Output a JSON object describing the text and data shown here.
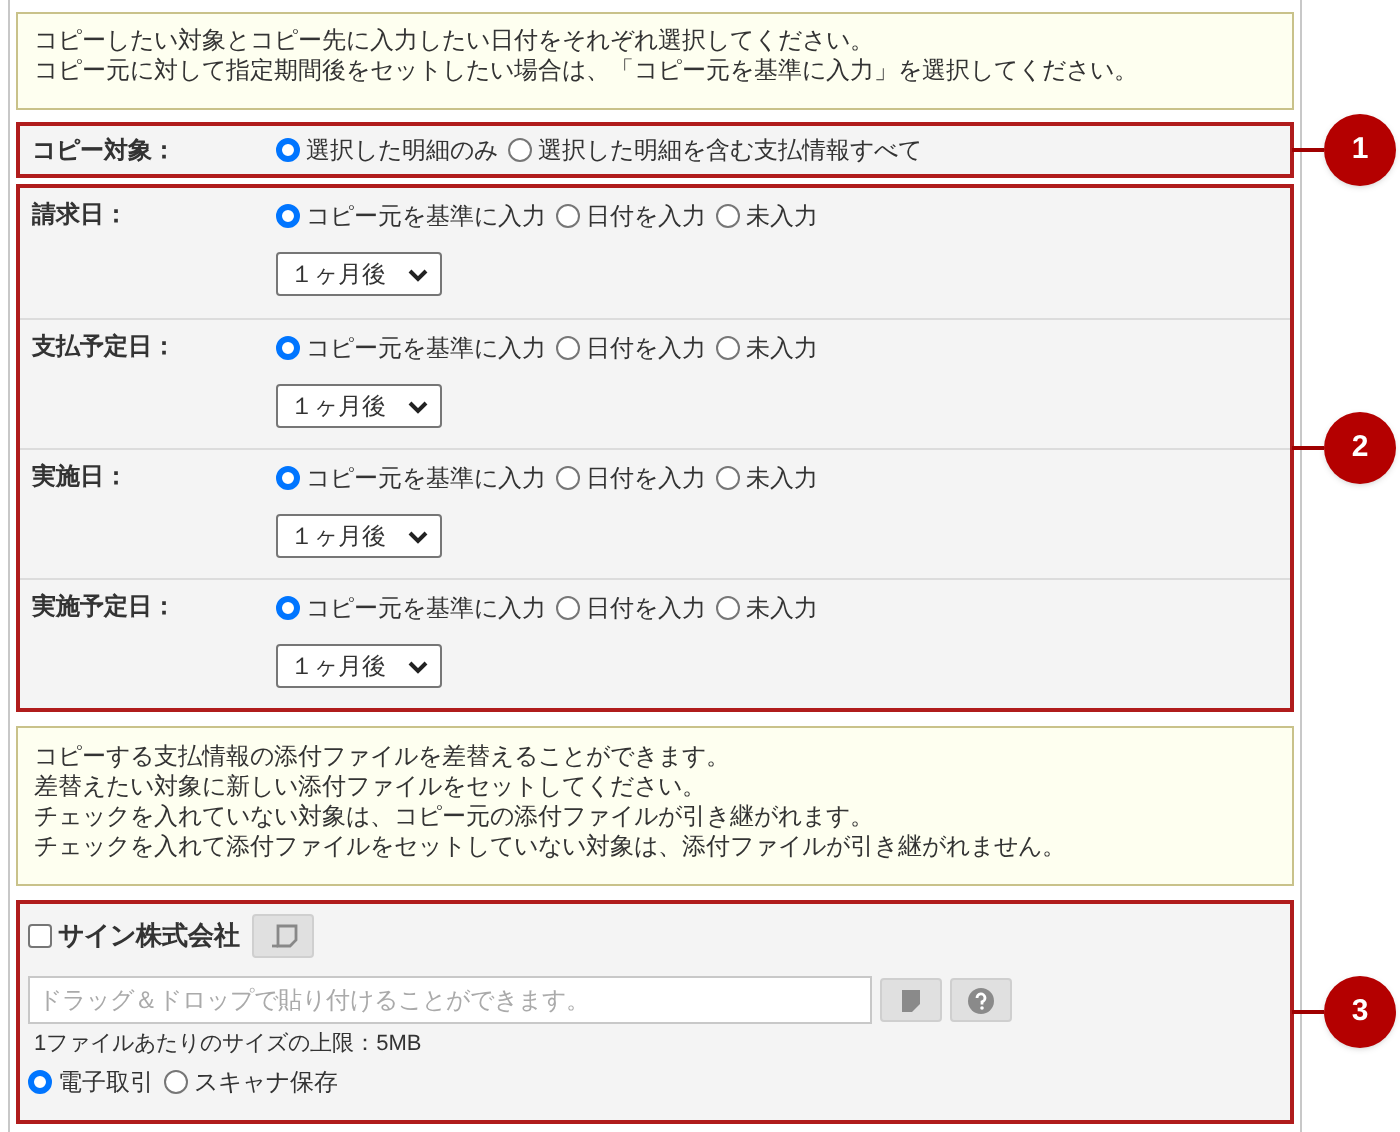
{
  "notice_top": [
    "コピーしたい対象とコピー先に入力したい日付をそれぞれ選択してください。",
    "コピー元に対して指定期間後をセットしたい場合は、「コピー元を基準に入力」を選択してください。"
  ],
  "copy_target": {
    "label": "コピー対象：",
    "options": [
      {
        "label": "選択した明細のみ",
        "selected": true
      },
      {
        "label": "選択した明細を含む支払情報すべて",
        "selected": false
      }
    ]
  },
  "date_fields": [
    {
      "label": "請求日：",
      "options": [
        {
          "label": "コピー元を基準に入力",
          "selected": true
        },
        {
          "label": "日付を入力",
          "selected": false
        },
        {
          "label": "未入力",
          "selected": false
        }
      ],
      "select_value": "１ヶ月後"
    },
    {
      "label": "支払予定日：",
      "options": [
        {
          "label": "コピー元を基準に入力",
          "selected": true
        },
        {
          "label": "日付を入力",
          "selected": false
        },
        {
          "label": "未入力",
          "selected": false
        }
      ],
      "select_value": "１ヶ月後"
    },
    {
      "label": "実施日：",
      "options": [
        {
          "label": "コピー元を基準に入力",
          "selected": true
        },
        {
          "label": "日付を入力",
          "selected": false
        },
        {
          "label": "未入力",
          "selected": false
        }
      ],
      "select_value": "１ヶ月後"
    },
    {
      "label": "実施予定日：",
      "options": [
        {
          "label": "コピー元を基準に入力",
          "selected": true
        },
        {
          "label": "日付を入力",
          "selected": false
        },
        {
          "label": "未入力",
          "selected": false
        }
      ],
      "select_value": "１ヶ月後"
    }
  ],
  "notice_attachments": [
    "コピーする支払情報の添付ファイルを差替えることができます。",
    "差替えたい対象に新しい添付ファイルをセットしてください。",
    "チェックを入れていない対象は、コピー元の添付ファイルが引き継がれます。",
    "チェックを入れて添付ファイルをセットしていない対象は、添付ファイルが引き継がれません。"
  ],
  "attachment": {
    "company": "サイン株式会社",
    "checked": false,
    "drop_placeholder": "ドラッグ＆ドロップで貼り付けることができます。",
    "size_limit": "1ファイルあたりのサイズの上限：5MB",
    "options": [
      {
        "label": "電子取引",
        "selected": true
      },
      {
        "label": "スキャナ保存",
        "selected": false
      }
    ]
  },
  "callouts": [
    "1",
    "2",
    "3"
  ]
}
